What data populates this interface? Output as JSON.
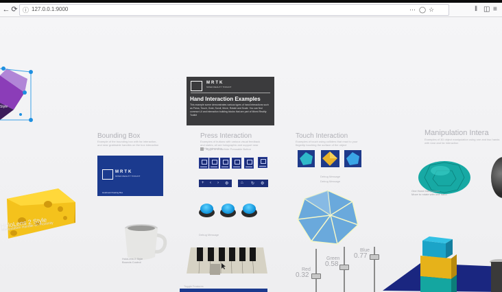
{
  "browser": {
    "url": "127.0.0.1:9000",
    "back_icon": "back-arrow-icon",
    "forward_icon": "forward-arrow-icon",
    "reload_icon": "reload-icon",
    "info_icon": "info-icon",
    "library_icon": "library-icon",
    "sidebar_icon": "sidebar-icon",
    "menu_icon": "hamburger-menu-icon"
  },
  "scene": {
    "hand_panel": {
      "brand": "MRTK",
      "brand_sub": "MIXED REALITY TOOLKIT",
      "title": "Hand Interaction Examples",
      "body": "This example scene demonstrates various types of hand interactions such as Press, Touch, Grab, Scroll, Move, Rotate and Scale. You can find common UI and interaction building blocks that are part of Mixed Reality Toolkit"
    },
    "sections": {
      "bounding_box": {
        "title": "Bounding Box",
        "desc": "Example of the bounding box with far interaction, and near grabbable handles on the box interaction"
      },
      "press": {
        "title": "Press Interaction",
        "desc": "Examples of buttons with various visual feedback and states; all are holographic and support near and far interaction"
      },
      "touch": {
        "title": "Touch Interaction",
        "desc": "Examples of touch using colliders that react to your fingertip touching the surface of the object"
      },
      "manipulation": {
        "title": "Manipulation Intera",
        "desc": "Examples of 3D object manipulation using one and two hands with near and far interaction"
      }
    },
    "bbox_panel": {
      "brand": "MRTK",
      "brand_sub": "MIXED REALITY TOOLKIT",
      "foot": "Holobook Floating Box"
    },
    "press_toggle": "Toggle to show/hide Pressable Button",
    "debug_message_1": "Debug Message",
    "debug_message_2": "Debug Message",
    "debug_message_3": "Debug Message",
    "toggle_features": "Toggle Features",
    "hololens_style_left": "HoloLens 2 Style",
    "hololens_style_left_sub": "Manipulation Handler on Proximity",
    "hololens_style_mug": "HoloLens 2 Style",
    "hololens_style_mug_sub": "Bounds Control",
    "object_manipulator": "One Hand Manipulated",
    "object_manipulator_sub": "Move to rotate with one hand",
    "sliders": {
      "red_label": "Red",
      "red_value": "0.32",
      "green_label": "Green",
      "green_value": "0.58",
      "blue_label": "Blue",
      "blue_value": "0.77"
    },
    "colors": {
      "mrtk_blue": "#1b3a8e",
      "button_cyan": "#1aa7f0",
      "cheese": "#f2c21b",
      "teal": "#1fb7b0"
    }
  }
}
